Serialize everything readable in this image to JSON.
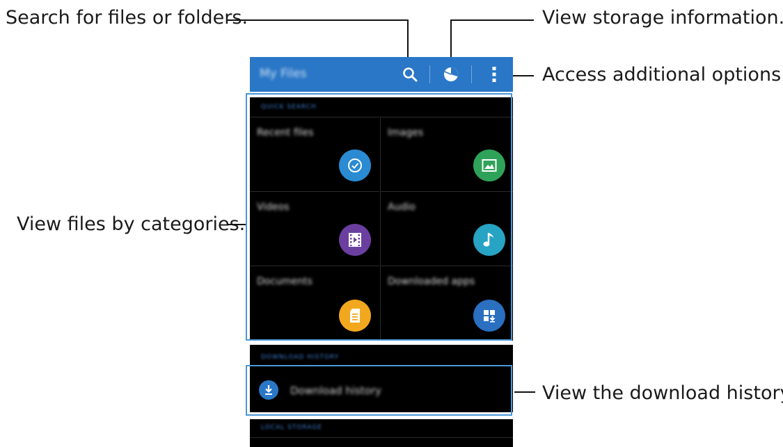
{
  "callouts": {
    "search": "Search for files or folders.",
    "storage": "View storage information.",
    "options": "Access additional options.",
    "categories": "View files by categories.",
    "history": "View the download history."
  },
  "appbar": {
    "title": "My Files",
    "icons": [
      "search-icon",
      "storage-pie-icon",
      "more-options-icon"
    ]
  },
  "sections": {
    "quick_search": "QUICK SEARCH",
    "download_history": "DOWNLOAD HISTORY",
    "local_storage": "LOCAL STORAGE"
  },
  "categories": [
    {
      "label": "Recent files",
      "icon": "clock-icon",
      "color": "#2a8ad2"
    },
    {
      "label": "Images",
      "icon": "image-icon",
      "color": "#2fa25a"
    },
    {
      "label": "Videos",
      "icon": "film-icon",
      "color": "#6b3fa0"
    },
    {
      "label": "Audio",
      "icon": "music-note-icon",
      "color": "#27a3c4"
    },
    {
      "label": "Documents",
      "icon": "document-icon",
      "color": "#f2a81e"
    },
    {
      "label": "Downloaded apps",
      "icon": "app-download-icon",
      "color": "#2a6fc0"
    }
  ],
  "download_history": {
    "label": "Download history",
    "icon": "download-icon"
  },
  "colors": {
    "appbar": "#2a77c7",
    "highlight": "#4a97d6"
  }
}
